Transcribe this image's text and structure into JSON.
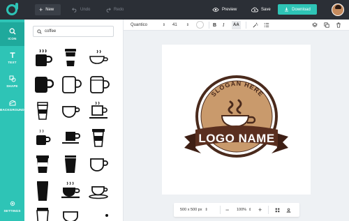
{
  "topbar": {
    "new_label": "New",
    "undo_label": "Undo",
    "redo_label": "Redo",
    "preview_label": "Preview",
    "save_label": "Save",
    "download_label": "Download"
  },
  "rail": {
    "items": [
      {
        "label": "ICON",
        "icon": "search-icon"
      },
      {
        "label": "TEXT",
        "icon": "text-icon"
      },
      {
        "label": "SHAPE",
        "icon": "shape-icon"
      },
      {
        "label": "BACKGROUND",
        "icon": "background-icon"
      },
      {
        "label": "SETTINGS",
        "icon": "gear-icon"
      }
    ]
  },
  "panel": {
    "search_value": "coffee"
  },
  "text_toolbar": {
    "font": "Quantico",
    "size": "41",
    "bold": "B",
    "italic": "I",
    "case": "AA"
  },
  "canvas": {
    "logo_top_text": "SLOGAN HERE",
    "logo_name": "LOGO NAME",
    "colors": {
      "ring": "#4a2a1c",
      "fill": "#c99a6c",
      "ribbon": "#5a2f1f"
    }
  },
  "bottom": {
    "dimensions": "500 x 500 px",
    "zoom": "100%"
  },
  "colors": {
    "accent": "#2ec4b6",
    "topbar": "#2b2f36"
  }
}
